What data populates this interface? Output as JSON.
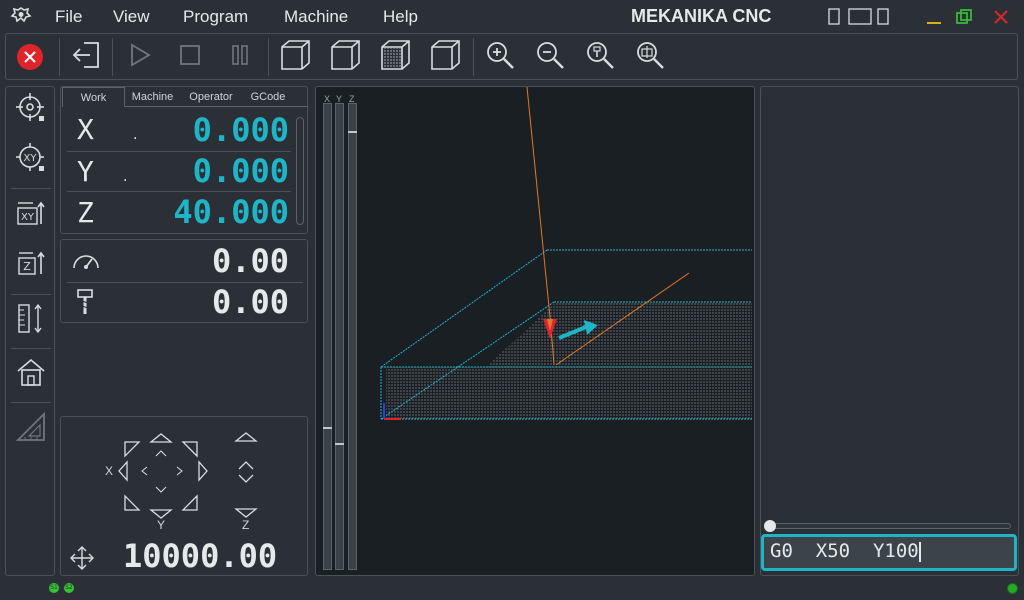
{
  "menu": {
    "file": "File",
    "view": "View",
    "program": "Program",
    "machine": "Machine",
    "help": "Help"
  },
  "app_title": "MEKANIKA CNC",
  "dro": {
    "tabs": [
      "Work",
      "Machine",
      "Operator",
      "GCode"
    ],
    "active_tab": "Work",
    "x_label": "X",
    "x_value": "0.000",
    "y_label": "Y",
    "y_value": "0.000",
    "z_label": "Z",
    "z_value": "40.000"
  },
  "feed_speed": {
    "feed_value": "0.00",
    "spindle_value": "0.00"
  },
  "jog": {
    "x_label": "X",
    "y_label": "Y",
    "z_label": "Z",
    "step_value": "10000.00"
  },
  "viewport": {
    "slider_labels": [
      "X",
      "Y",
      "Z"
    ]
  },
  "mdi": {
    "command": "G0  X50  Y100"
  },
  "status_leds": [
    "S1",
    "S2"
  ],
  "colors": {
    "accent": "#1fb5c9",
    "stop": "#e0242c",
    "path": "#e07a2a",
    "background": "#2a3035",
    "viewport": "#1a1f24"
  }
}
